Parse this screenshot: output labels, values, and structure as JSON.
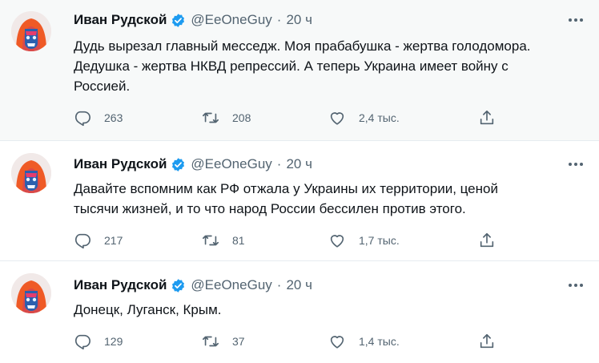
{
  "tweets": [
    {
      "author": "Иван Рудской",
      "handle": "@EeOneGuy",
      "separator": "·",
      "time": "20 ч",
      "lines": [
        "Дудь вырезал главный месседж. Моя прабабушка - жертва голодомора.",
        "Дедушка - жертва НКВД репрессий. А теперь Украина имеет войну с",
        "Россией."
      ],
      "replies": "263",
      "retweets": "208",
      "likes": "2,4 тыс."
    },
    {
      "author": "Иван Рудской",
      "handle": "@EeOneGuy",
      "separator": "·",
      "time": "20 ч",
      "lines": [
        "Давайте вспомним как РФ отжала у Украины их территории, ценой",
        "тысячи жизней, и то что народ России бессилен против этого."
      ],
      "replies": "217",
      "retweets": "81",
      "likes": "1,7 тыс."
    },
    {
      "author": "Иван Рудской",
      "handle": "@EeOneGuy",
      "separator": "·",
      "time": "20 ч",
      "lines": [
        "Донецк, Луганск, Крым."
      ],
      "replies": "129",
      "retweets": "37",
      "likes": "1,4 тыс."
    }
  ],
  "icons": {
    "verified": "verified-badge-icon",
    "more": "more-options-icon",
    "reply": "reply-icon",
    "retweet": "retweet-icon",
    "like": "like-heart-icon",
    "share": "share-icon"
  },
  "colors": {
    "verified_blue": "#1d9bf0",
    "secondary_text": "#536471",
    "highlight_background": "#f7f9f9",
    "divider": "#e6ecf0"
  }
}
